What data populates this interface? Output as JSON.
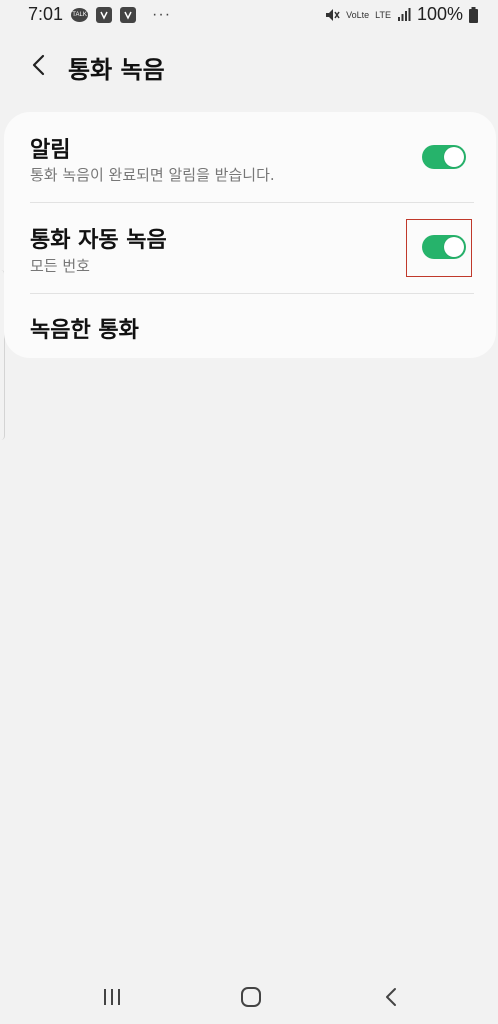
{
  "status_bar": {
    "time": "7:01",
    "notification_icons": [
      "talk-icon",
      "naver-icon",
      "naver-icon"
    ],
    "talk_label": "TALK",
    "more_dots": "···",
    "volte_label": "VoLte",
    "lte_label": "LTE",
    "battery_text": "100%"
  },
  "header": {
    "title": "통화 녹음",
    "back_icon": "chevron-left-icon"
  },
  "settings": {
    "notification": {
      "title": "알림",
      "subtitle": "통화 녹음이 완료되면 알림을 받습니다.",
      "enabled": true
    },
    "auto_record": {
      "title": "통화 자동 녹음",
      "subtitle": "모든 번호",
      "enabled": true
    },
    "recorded_calls": {
      "title": "녹음한 통화"
    }
  },
  "colors": {
    "accent": "#26b36b",
    "background": "#f2f2f2",
    "card": "#fbfbfb",
    "highlight": "#c0392b"
  },
  "nav_bar": {
    "icons": [
      "recent-apps-icon",
      "home-icon",
      "back-icon"
    ]
  }
}
